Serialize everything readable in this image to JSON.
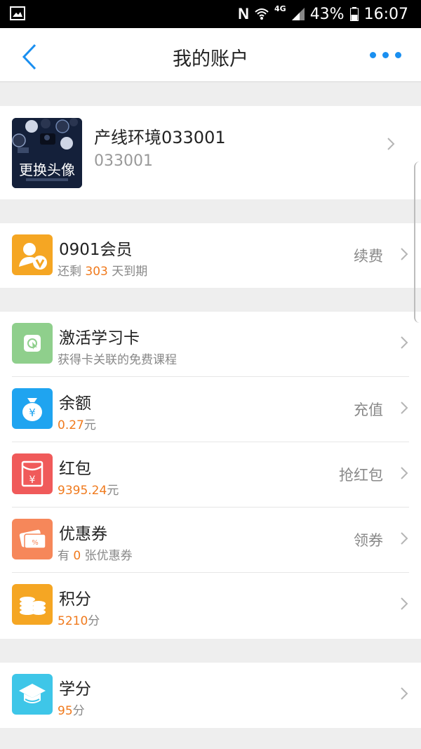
{
  "statusbar": {
    "battery": "43%",
    "time": "16:07",
    "network": "4G"
  },
  "header": {
    "title": "我的账户"
  },
  "profile": {
    "avatar_label": "更换头像",
    "name": "产线环境033001",
    "uid": "033001"
  },
  "membership": {
    "title": "0901会员",
    "sub_prefix": "还剩",
    "days": "303",
    "sub_suffix": "天到期",
    "action": "续费",
    "icon_color": "#f5a623"
  },
  "items": [
    {
      "title": "激活学习卡",
      "sub_text": "获得卡关联的免费课程",
      "icon_color": "#8fcf8c"
    },
    {
      "title": "余额",
      "value": "0.27",
      "unit": "元",
      "action": "充值",
      "icon_color": "#1fa4f0"
    },
    {
      "title": "红包",
      "value": "9395.24",
      "unit": "元",
      "action": "抢红包",
      "icon_color": "#f05a5a"
    },
    {
      "title": "优惠券",
      "sub_prefix": "有",
      "value": "0",
      "sub_suffix": "张优惠券",
      "action": "领券",
      "icon_color": "#f6875a"
    },
    {
      "title": "积分",
      "value": "5210",
      "unit": "分",
      "icon_color": "#f5a623"
    }
  ],
  "credit": {
    "title": "学分",
    "value": "95",
    "unit": "分",
    "icon_color": "#3ec6e8"
  }
}
